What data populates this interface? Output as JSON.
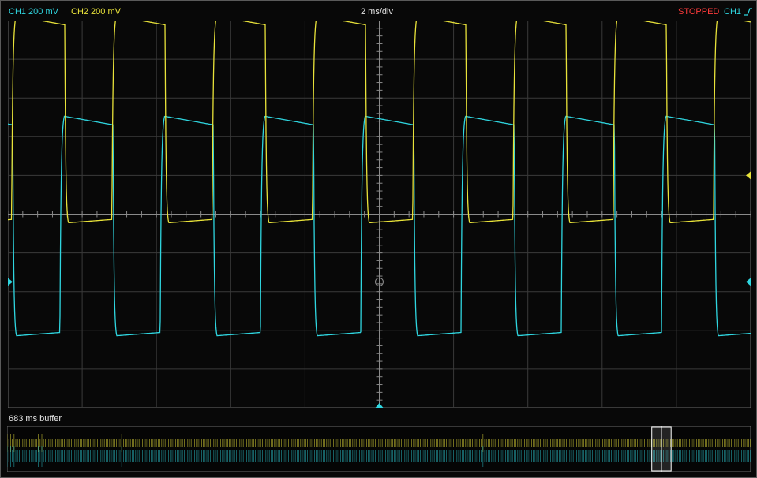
{
  "header": {
    "ch1_label": "CH1 200 mV",
    "ch2_label": "CH2 200 mV",
    "timebase": "2 ms/div",
    "status": "STOPPED",
    "trigger_source": "CH1",
    "trigger_slope_icon": "rising-edge-icon"
  },
  "buffer": {
    "label": "683 ms buffer",
    "window_start": 0.867,
    "window_end": 0.893
  },
  "colors": {
    "ch1": "#2fd6e0",
    "ch2": "#e8e23a",
    "stopped": "#ff3b3b",
    "grid": "#3a3a3a",
    "background": "#080808"
  },
  "chart_data": {
    "type": "line",
    "x_unit": "ms",
    "xlim": [
      -10,
      10
    ],
    "y_unit": "V",
    "ylim": [
      -0.9,
      0.9
    ],
    "grid": true,
    "series": [
      {
        "name": "CH1",
        "period_ms": 2.7,
        "high": 0.77,
        "low": -0.25,
        "phase_ms": -8.6,
        "duty": 0.53,
        "offset_div": -1.75
      },
      {
        "name": "CH2",
        "period_ms": 2.7,
        "high": 0.74,
        "low": -0.22,
        "phase_ms": -9.9,
        "duty": 0.53,
        "offset_div": 1.0
      }
    ]
  }
}
